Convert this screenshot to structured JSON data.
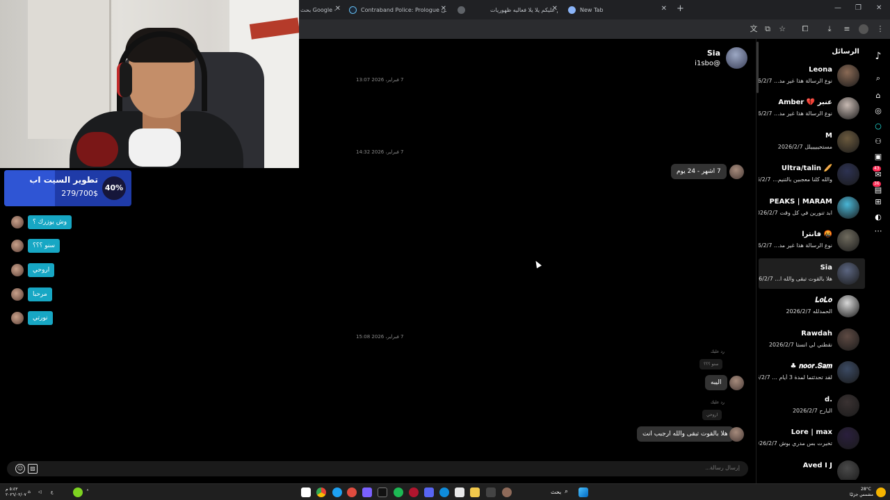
{
  "browser": {
    "tabs": [
      {
        "label": "بحث Google -"
      },
      {
        "label": "Contraband Police: Prologue على Steam"
      },
      {
        "label": "السلام عليكم يلا يلا فعاليه ظهوريات"
      },
      {
        "label": "New Tab"
      }
    ]
  },
  "goal": {
    "title": "تطوير السيت اب",
    "amount": "279/700$",
    "percent_label": "40%",
    "progress": 0.4
  },
  "overlay_chat": [
    {
      "text": "وش يوزرك ؟"
    },
    {
      "text": "سنو ؟؟؟"
    },
    {
      "text": "اروحي"
    },
    {
      "text": "مرحبا"
    },
    {
      "text": "نورتي"
    }
  ],
  "conversation": {
    "name": "Sia",
    "handle": "i1sbo@",
    "dates": [
      "7 فبراير، 2026 13:07",
      "7 فبراير، 2026 14:32",
      "7 فبراير، 2026 15:08"
    ],
    "messages": [
      {
        "text": "7 اشهر - 24 يوم"
      },
      {
        "reply_label": "رد عليك",
        "quote": "سنو ؟؟؟",
        "text": "اليبه"
      },
      {
        "reply_label": "رد عليك",
        "quote": "اروحي",
        "text": "هلا بالقوت تبقى والله ارجبب انت"
      }
    ],
    "composer_placeholder": "إرسال رسالة..."
  },
  "sidebar": {
    "title": "الرسائل",
    "items": [
      {
        "name": "Leona",
        "preview": "نوع الرسالة هذا غير مد... 2026/2/7",
        "color": "#8a6a55"
      },
      {
        "name": "Amber 💔 عنبر",
        "preview": "نوع الرسالة هذا غير مد... 2026/2/7",
        "color": "#c7b9b2"
      },
      {
        "name": "M",
        "preview": "مستحيييييلل 2026/2/7",
        "color": "#6b5a3e"
      },
      {
        "name": "Ultra/talin 🥖",
        "preview": "والله كلنا معجبين بالتنيم... 2026/2/7",
        "color": "#2d3252"
      },
      {
        "name": "PEAKS | MARAM",
        "preview": "ابد تنورين في كل وقت 2026/2/7",
        "color": "#49b6d6"
      },
      {
        "name": "فانترا 🤬",
        "preview": "نوع الرسالة هذا غير مد... 2026/2/7",
        "color": "#6f6b5e"
      },
      {
        "name": "Sia",
        "preview": "هلا بالقوت تبقى والله ا... 2026/2/7",
        "color": "#5b6580"
      },
      {
        "name": "𝑳𝒐𝑳𝒐",
        "preview": "الحمدلله 2026/2/7",
        "color": "#d8d8d8"
      },
      {
        "name": "Rawdah",
        "preview": "نقطني لي انستا 2026/2/7",
        "color": "#5e4a43"
      },
      {
        "name": "♣ 𝒏𝒐𝒐𝒓.𝑺𝒂𝒎",
        "preview": "لقد تحدثتما لمدة 3 أيام ... 2026/2/7",
        "color": "#3b4a63"
      },
      {
        "name": "d.",
        "preview": "البارح 2026/2/7",
        "color": "#3a3232"
      },
      {
        "name": "Lore | max",
        "preview": "تخيرت بس مدري بوش 2026/2/7",
        "color": "#2a1f3d"
      },
      {
        "name": "Aved I J",
        "preview": "",
        "color": "#4a4a4a"
      }
    ]
  },
  "rail": {
    "badge1": "43",
    "badge2": "36"
  },
  "taskbar": {
    "search_label": "بحث",
    "time": "٥:٤٣ م",
    "date": "٢٠٢٦/٠٢/٠٧",
    "weather": "28°C",
    "weather_desc": "مشمس جزئيًا"
  }
}
